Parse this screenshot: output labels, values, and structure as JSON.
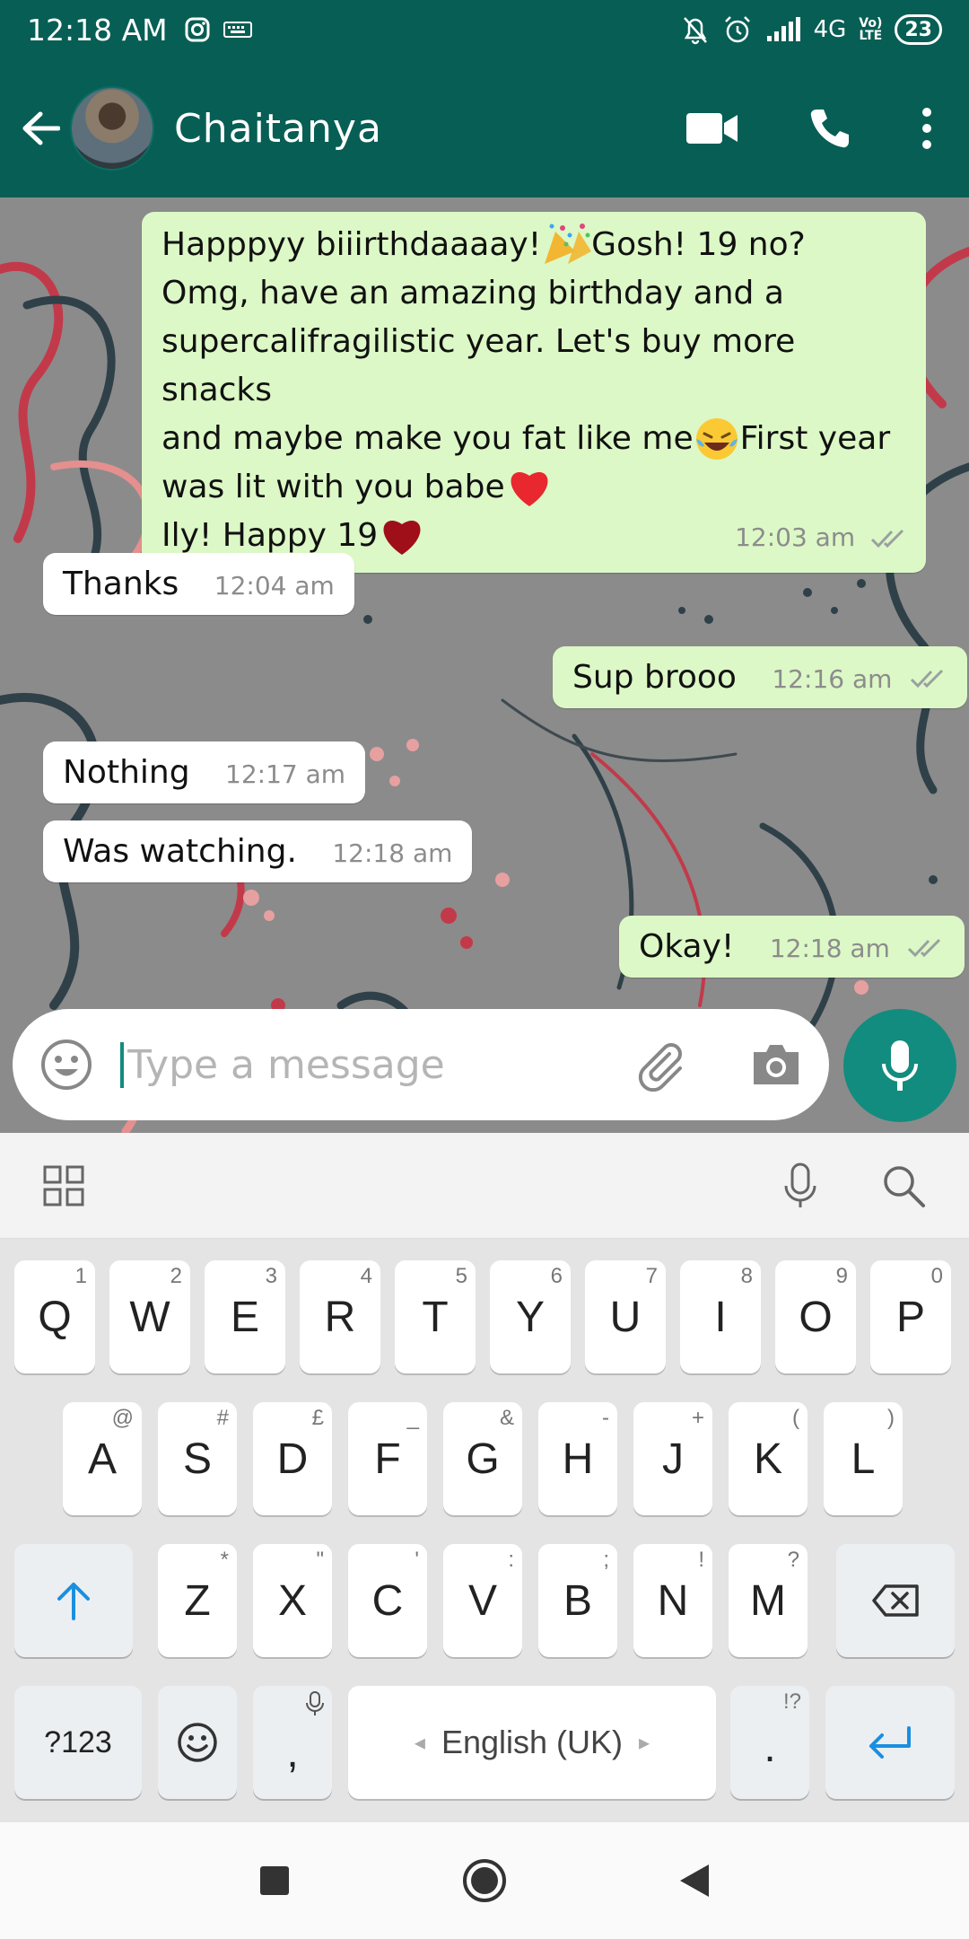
{
  "status_bar": {
    "time": "12:18 AM",
    "network": "4G",
    "volte_top": "Vo)",
    "volte_bottom": "LTE",
    "battery": "23",
    "icons": [
      "instagram-icon",
      "keyboard-icon",
      "mute-icon",
      "alarm-icon",
      "signal-icon"
    ]
  },
  "header": {
    "contact_name": "Chaitanya",
    "icons": [
      "back-arrow-icon",
      "video-call-icon",
      "voice-call-icon",
      "more-vert-icon"
    ]
  },
  "messages": [
    {
      "direction": "out",
      "lines": [
        "Happpyy biiirthdaaaay!",
        " Gosh! 19 no?",
        "Omg, have an amazing birthday and a",
        "supercalifragilistic year. Let's buy more snacks",
        "and maybe make you fat like me",
        " First year",
        "was lit with you babe",
        "Ily! Happy 19"
      ],
      "time": "12:03 am",
      "status": "read"
    },
    {
      "direction": "in",
      "text": "Thanks",
      "time": "12:04 am"
    },
    {
      "direction": "out",
      "text": "Sup brooo",
      "time": "12:16 am",
      "status": "read"
    },
    {
      "direction": "in",
      "text": "Nothing",
      "time": "12:17 am"
    },
    {
      "direction": "in",
      "text": "Was watching.",
      "time": "12:18 am"
    },
    {
      "direction": "out",
      "text": "Okay!",
      "time": "12:18 am",
      "status": "read"
    }
  ],
  "composer": {
    "placeholder": "Type a message",
    "icons": [
      "emoji-icon",
      "attach-icon",
      "camera-icon",
      "mic-icon"
    ]
  },
  "keyboard": {
    "toolbar_icons": [
      "apps-grid-icon",
      "voice-input-icon",
      "search-icon"
    ],
    "row1": [
      {
        "k": "Q",
        "s": "1"
      },
      {
        "k": "W",
        "s": "2"
      },
      {
        "k": "E",
        "s": "3"
      },
      {
        "k": "R",
        "s": "4"
      },
      {
        "k": "T",
        "s": "5"
      },
      {
        "k": "Y",
        "s": "6"
      },
      {
        "k": "U",
        "s": "7"
      },
      {
        "k": "I",
        "s": "8"
      },
      {
        "k": "O",
        "s": "9"
      },
      {
        "k": "P",
        "s": "0"
      }
    ],
    "row2": [
      {
        "k": "A",
        "s": "@"
      },
      {
        "k": "S",
        "s": "#"
      },
      {
        "k": "D",
        "s": "£"
      },
      {
        "k": "F",
        "s": "_"
      },
      {
        "k": "G",
        "s": "&"
      },
      {
        "k": "H",
        "s": "-"
      },
      {
        "k": "J",
        "s": "+"
      },
      {
        "k": "K",
        "s": "("
      },
      {
        "k": "L",
        "s": ")"
      }
    ],
    "row3": [
      {
        "k": "Z",
        "s": "*"
      },
      {
        "k": "X",
        "s": "\""
      },
      {
        "k": "C",
        "s": "'"
      },
      {
        "k": "V",
        "s": ":"
      },
      {
        "k": "B",
        "s": ";"
      },
      {
        "k": "N",
        "s": "!"
      },
      {
        "k": "M",
        "s": "?"
      }
    ],
    "symbols_label": "?123",
    "comma_label": ",",
    "space_label": "English (UK)",
    "period_label": ".",
    "period_sup": "!?"
  },
  "nav_bar": {
    "icons": [
      "recents-icon",
      "home-icon",
      "back-icon"
    ]
  },
  "colors": {
    "header": "#075e54",
    "accent": "#128c7e",
    "outgoing_bubble": "#dcf8c6",
    "incoming_bubble": "#ffffff",
    "read_tick": "#8c8c8c",
    "enter_key": "#1a8fe0"
  }
}
